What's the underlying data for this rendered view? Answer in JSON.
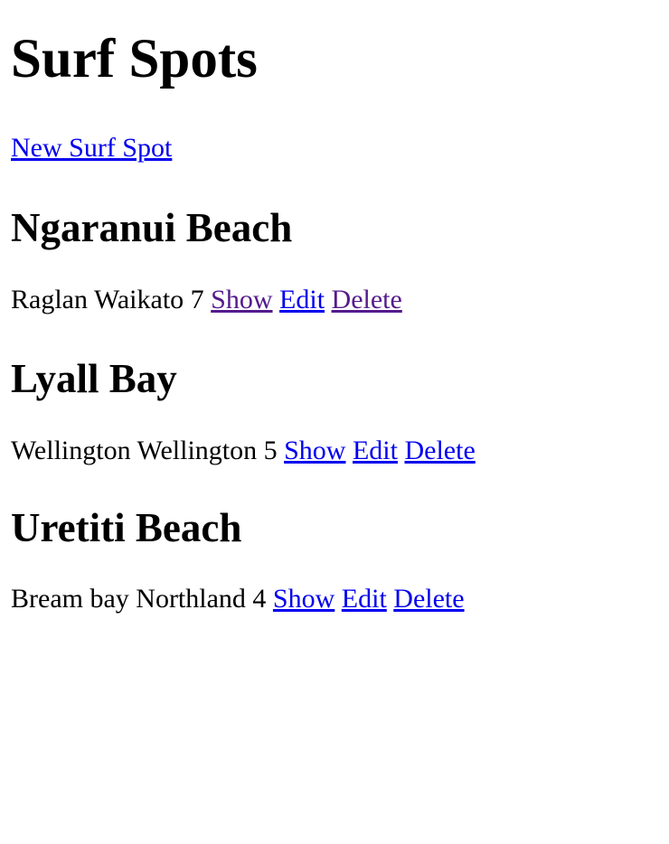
{
  "page": {
    "title": "Surf Spots",
    "new_link": "New Surf Spot"
  },
  "spots": [
    {
      "name": "Ngaranui Beach",
      "town": "Raglan",
      "region": "Waikato",
      "rating": "7",
      "show": "Show",
      "edit": "Edit",
      "delete": "Delete"
    },
    {
      "name": "Lyall Bay",
      "town": "Wellington",
      "region": "Wellington",
      "rating": "5",
      "show": "Show",
      "edit": "Edit",
      "delete": "Delete"
    },
    {
      "name": "Uretiti Beach",
      "town": "Bream bay",
      "region": "Northland",
      "rating": "4",
      "show": "Show",
      "edit": "Edit",
      "delete": "Delete"
    }
  ],
  "colors": {
    "link": "#0000ee",
    "visited_link": "#551a8b",
    "text": "#000000",
    "background": "#ffffff"
  }
}
